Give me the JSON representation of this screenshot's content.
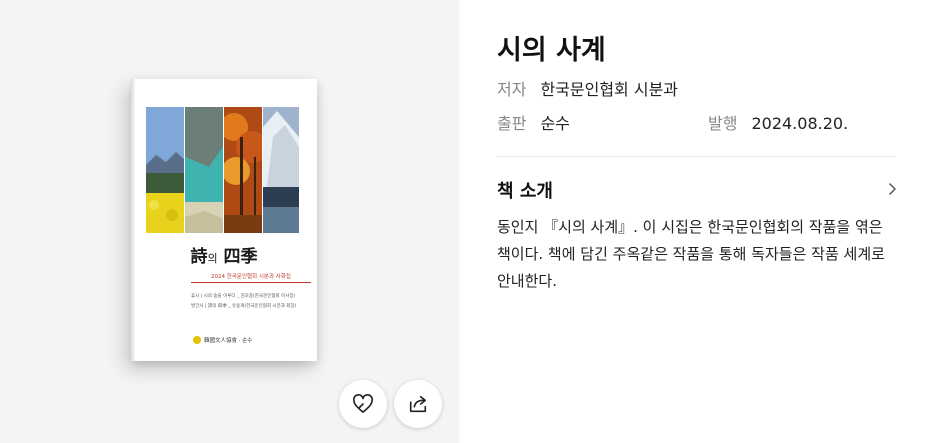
{
  "book": {
    "title": "시의 사계",
    "author_label": "저자",
    "author": "한국문인협회 시분과",
    "publisher_label": "출판",
    "publisher": "순수",
    "date_label": "발행",
    "date": "2024.08.20."
  },
  "intro": {
    "heading": "책 소개",
    "text": "동인지 『시의 사계』. 이 시집은 한국문인협회의 작품을 엮은 책이다. 책에 담긴 주옥같은 작품을 통해 독자들은 작품 세계로 안내한다."
  },
  "cover": {
    "title_main_1": "詩",
    "title_small": "의",
    "title_main_2": "四季",
    "subtitle": "2024 한국문인협회 시분과 사화집",
    "line_1": "휴시 | 시의 숲을 이루다 _ 김호중(한국문인협회 이사장)",
    "line_2": "발간사 | 詩의 四季 _ 유용개(한국문인협회 시분과 회장)",
    "publisher": "韓國文人協會 · 순수"
  },
  "actions": {
    "like_icon": "heart-icon",
    "share_icon": "share-icon",
    "chevron_icon": "chevron-right-icon"
  }
}
